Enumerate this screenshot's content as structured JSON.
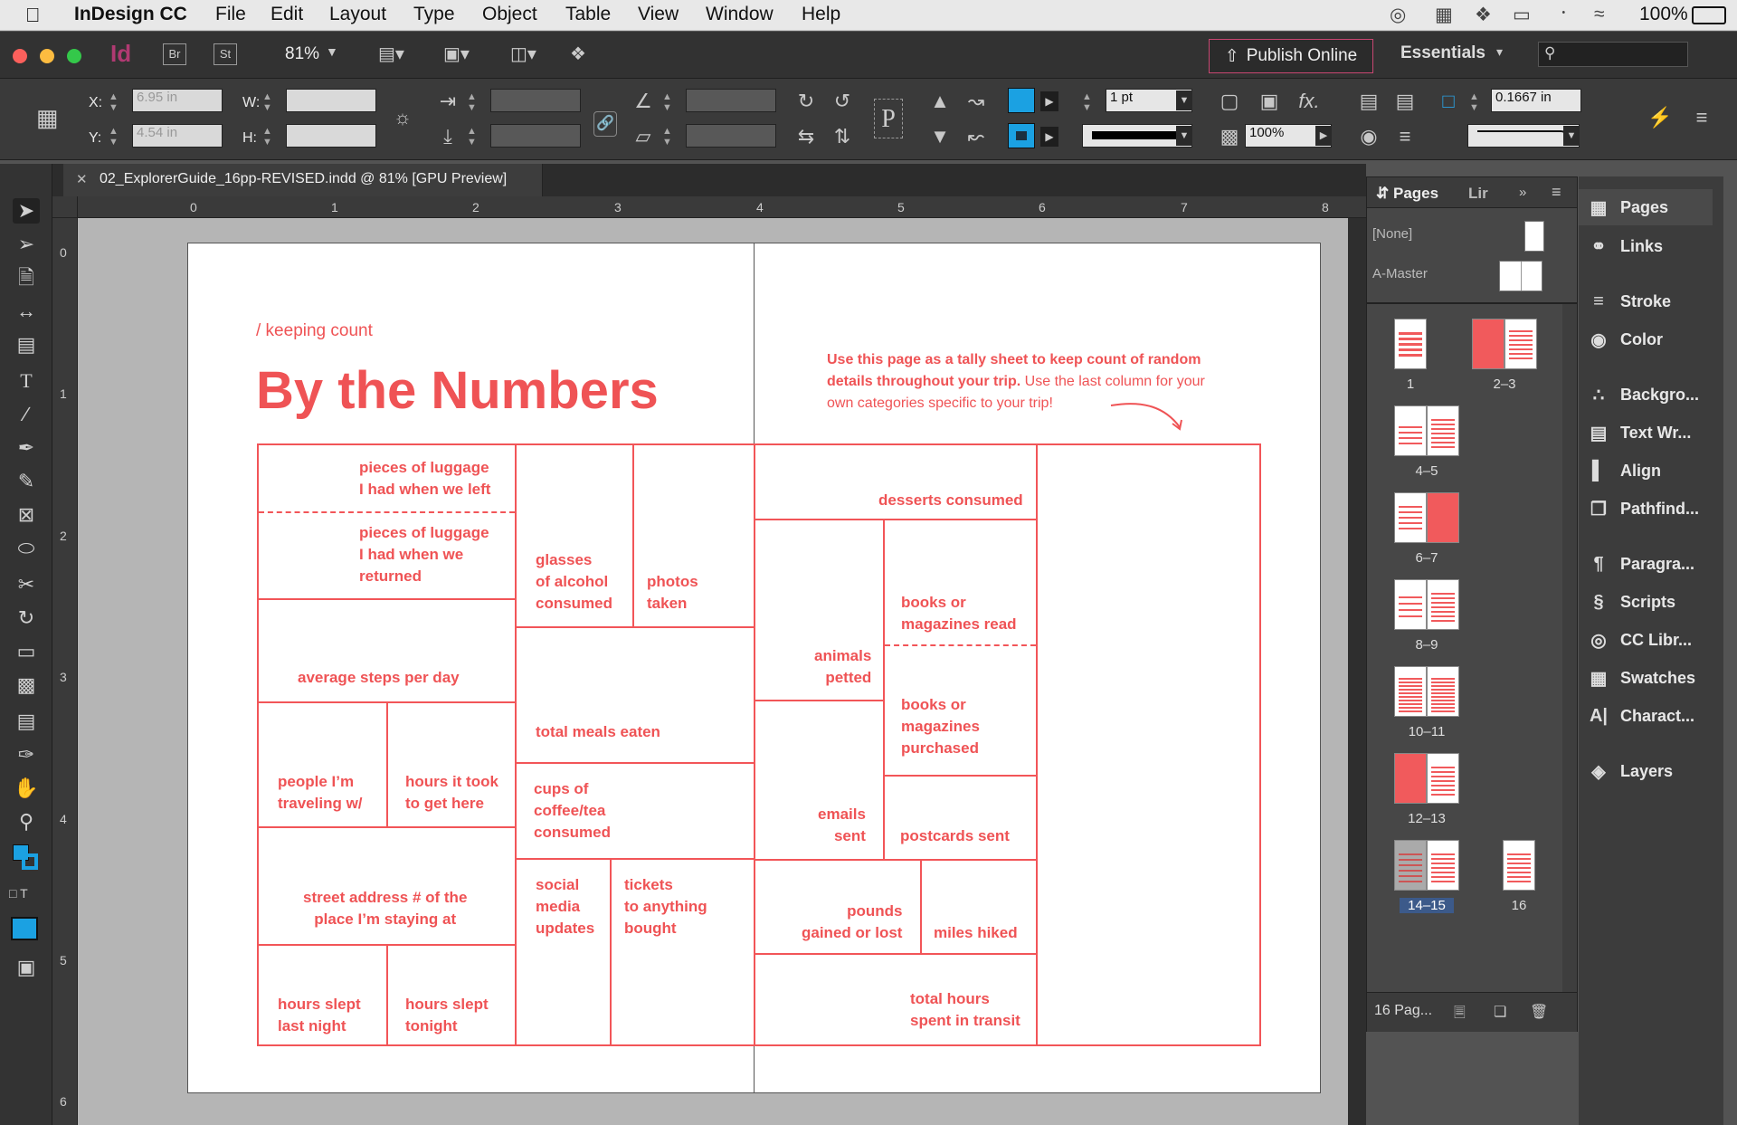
{
  "menubar": {
    "app": "InDesign CC",
    "items": [
      "File",
      "Edit",
      "Layout",
      "Type",
      "Object",
      "Table",
      "View",
      "Window",
      "Help"
    ],
    "battery": "100%"
  },
  "appbar": {
    "logo": "Id",
    "br": "Br",
    "st": "St",
    "zoom": "81%",
    "publish": "Publish Online",
    "workspace": "Essentials"
  },
  "control": {
    "x_label": "X:",
    "y_label": "Y:",
    "w_label": "W:",
    "h_label": "H:",
    "x_value": "6.95 in",
    "y_value": "4.54 in",
    "stroke_weight": "1 pt",
    "opacity": "100%",
    "offset": "0.1667 in"
  },
  "document": {
    "tab_title": "02_ExplorerGuide_16pp-REVISED.indd @ 81% [GPU Preview]"
  },
  "rulers": {
    "h": [
      "0",
      "1",
      "2",
      "3",
      "4",
      "5",
      "6",
      "7",
      "8"
    ],
    "v": [
      "0",
      "1",
      "2",
      "3",
      "4",
      "5",
      "6"
    ]
  },
  "spread": {
    "kicker": "/ keeping count",
    "title": "By the Numbers",
    "instructions_bold": "Use this page as a tally sheet to keep count of random\ndetails throughout your trip.",
    "instructions_rest_1": " Use the last column for your",
    "instructions_rest_2": "own categories specific to your trip!",
    "labels": {
      "luggage_left": "pieces of luggage\nI had when we left",
      "luggage_returned": "pieces of luggage\nI had when we\nreturned",
      "glasses": "glasses\nof alcohol\nconsumed",
      "photos": "photos\ntaken",
      "steps": "average steps per day",
      "meals": "total meals eaten",
      "people": "people I’m\ntraveling w/",
      "hours_here": "hours it took\nto get here",
      "coffee": "cups of\ncoffee/tea\nconsumed",
      "street": "street address # of the\nplace I’m staying at",
      "social": "social\nmedia\nupdates",
      "tickets": "tickets\nto anything\nbought",
      "slept_last": "hours slept\nlast night",
      "slept_tonight": "hours slept\ntonight",
      "desserts": "desserts consumed",
      "books_read": "books or\nmagazines read",
      "animals": "animals\npetted",
      "books_bought": "books or\nmagazines\npurchased",
      "emails": "emails\nsent",
      "postcards": "postcards sent",
      "pounds": "pounds\ngained or lost",
      "miles": "miles hiked",
      "transit": "total hours\nspent in transit"
    }
  },
  "pages_panel": {
    "tab_pages": "Pages",
    "tab_links": "Lir",
    "none_master": "[None]",
    "a_master": "A-Master",
    "spreads": [
      "1",
      "2–3",
      "4–5",
      "6–7",
      "8–9",
      "10–11",
      "12–13",
      "14–15",
      "16"
    ],
    "footer": "16 Pag..."
  },
  "dock": {
    "items": [
      "Pages",
      "Links",
      "Stroke",
      "Color",
      "Backgro...",
      "Text Wr...",
      "Align",
      "Pathfind...",
      "Paragra...",
      "Scripts",
      "CC Libr...",
      "Swatches",
      "Charact...",
      "Layers"
    ]
  },
  "colors": {
    "accent_red": "#ef5355",
    "fill_blue": "#1ba1e2"
  }
}
